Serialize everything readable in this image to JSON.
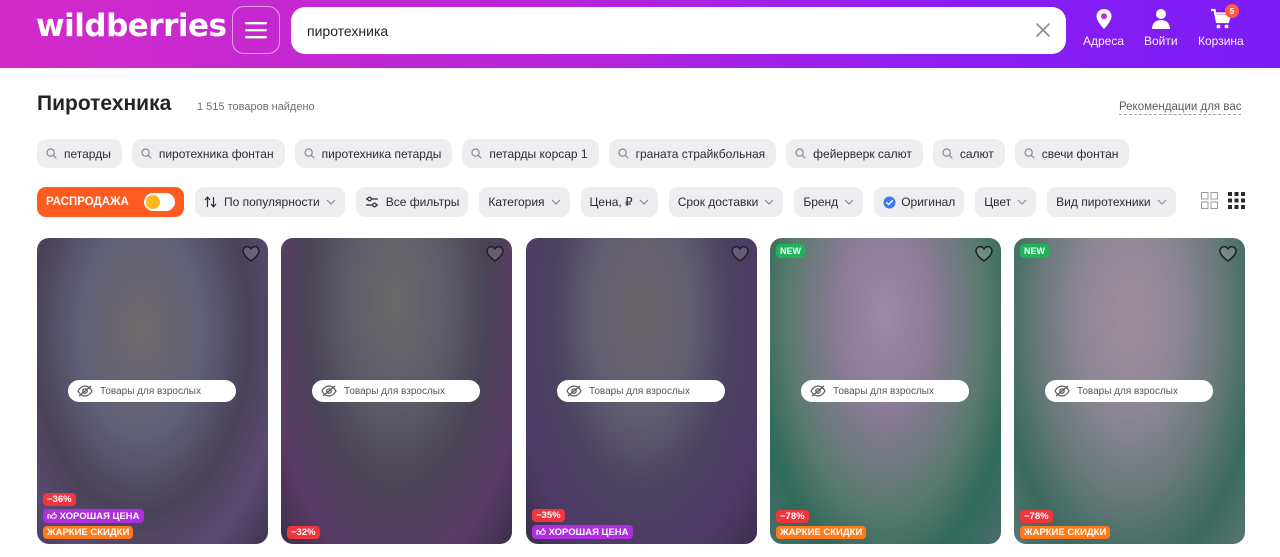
{
  "header": {
    "logo": "wildberries",
    "search_value": "пиротехника",
    "nav": [
      {
        "label": "Адреса",
        "icon": "location-pin-icon"
      },
      {
        "label": "Войти",
        "icon": "user-icon"
      },
      {
        "label": "Корзина",
        "icon": "cart-icon",
        "badge": "5"
      }
    ],
    "gradient_colors": [
      "#d22bc8",
      "#7a1df5"
    ]
  },
  "page": {
    "title": "Пиротехника",
    "count": "1 515 товаров найдено",
    "recommendations": "Рекомендации для вас"
  },
  "suggestions": [
    "петарды",
    "пиротехника фонтан",
    "пиротехника петарды",
    "петарды корсар 1",
    "граната страйкбольная",
    "фейерверк салют",
    "салют",
    "свечи фонтан"
  ],
  "filters": {
    "sale_label": "РАСПРОДАЖА",
    "sale_on": true,
    "sort_label": "По популярности",
    "all_filters_label": "Все фильтры",
    "items": [
      "Категория",
      "Цена, ₽",
      "Срок доставки",
      "Бренд"
    ],
    "original_label": "Оригинал",
    "items2": [
      "Цвет",
      "Вид пиротехники"
    ]
  },
  "products": [
    {
      "is_new": false,
      "adult_label": "Товары для взрослых",
      "badges": [
        {
          "text": "−36%",
          "kind": "discount"
        },
        {
          "text": "ХОРОШАЯ ЦЕНА",
          "kind": "good"
        },
        {
          "text": "ЖАРКИЕ СКИДКИ",
          "kind": "hot"
        }
      ]
    },
    {
      "is_new": false,
      "adult_label": "Товары для взрослых",
      "badges": [
        {
          "text": "−32%",
          "kind": "discount"
        }
      ]
    },
    {
      "is_new": false,
      "adult_label": "Товары для взрослых",
      "badges": [
        {
          "text": "−35%",
          "kind": "discount"
        },
        {
          "text": "ХОРОШАЯ ЦЕНА",
          "kind": "good"
        }
      ]
    },
    {
      "is_new": true,
      "new_label": "NEW",
      "adult_label": "Товары для взрослых",
      "badges": [
        {
          "text": "−78%",
          "kind": "discount"
        },
        {
          "text": "ЖАРКИЕ СКИДКИ",
          "kind": "hot"
        }
      ]
    },
    {
      "is_new": true,
      "new_label": "NEW",
      "adult_label": "Товары для взрослых",
      "badges": [
        {
          "text": "−78%",
          "kind": "discount"
        },
        {
          "text": "ЖАРКИЕ СКИДКИ",
          "kind": "hot"
        }
      ]
    }
  ]
}
